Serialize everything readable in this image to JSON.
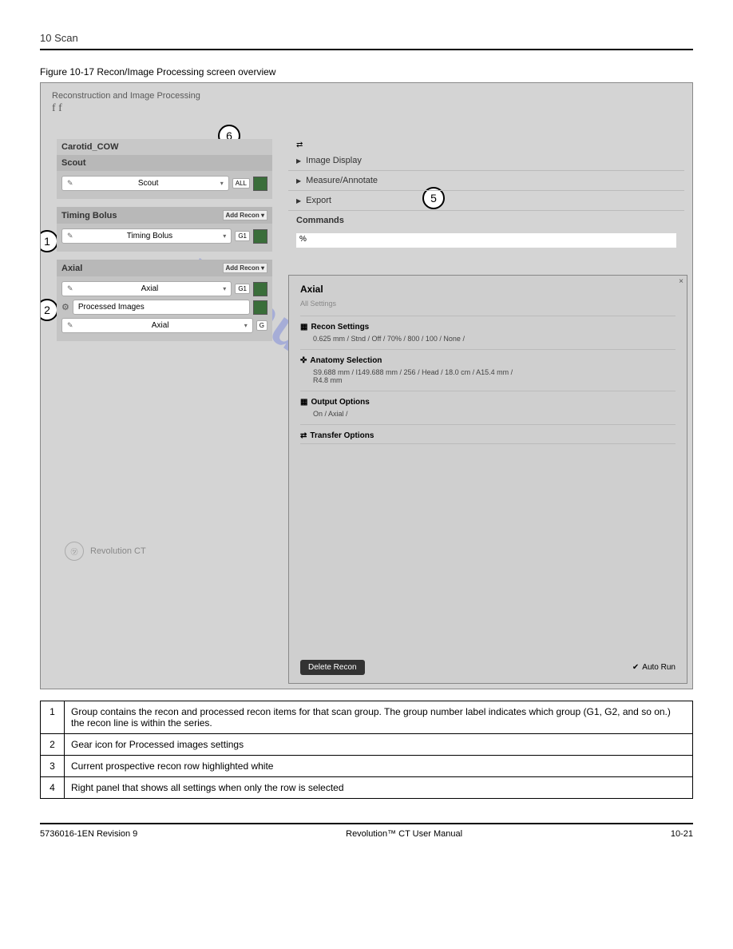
{
  "chapter": {
    "num": "10",
    "title": "Scan"
  },
  "figure_label": "Figure 10-17 Recon/Image Processing screen overview",
  "app_header": "Reconstruction and Image Processing",
  "app_sub": "f f",
  "protocol": "Carotid_COW",
  "sections": {
    "scout": {
      "header": "Scout",
      "item": "Scout",
      "badge": "ALL"
    },
    "timing": {
      "header": "Timing Bolus",
      "add": "Add Recon",
      "item": "Timing Bolus",
      "badge": "G1"
    },
    "axial": {
      "header": "Axial",
      "add": "Add Recon",
      "item1": "Axial",
      "badge1": "G1",
      "processed": "Processed Images",
      "item2": "Axial"
    }
  },
  "right_items": [
    "Image Display",
    "Measure/Annotate",
    "Export",
    "Commands"
  ],
  "cmd_value": "%",
  "panel": {
    "title": "Axial",
    "subtitle": "All Settings",
    "recon_title": "Recon Settings",
    "recon_vals": "0.625 mm  /  Stnd  /  Off  /  70%  /  800  /  100  /  None  /",
    "anatomy_title": "Anatomy Selection",
    "anatomy_vals": "S9.688 mm  /  I149.688 mm  /  256  /  Head  /  18.0 cm  /  A15.4 mm  /",
    "anatomy_vals2": "R4.8 mm",
    "output_title": "Output Options",
    "output_vals": "On  /  Axial  /",
    "transfer_title": "Transfer Options",
    "delete": "Delete Recon",
    "autorun": "Auto Run"
  },
  "brand": "Revolution CT",
  "watermark": "manualshive.com",
  "table": [
    {
      "n": "1",
      "t": "Group contains the recon and processed recon items for that scan group. The group number label indicates which group (G1, G2, and so on.) the recon line is within the series."
    },
    {
      "n": "2",
      "t": "Gear icon for Processed images settings"
    },
    {
      "n": "3",
      "t": "Current prospective recon row highlighted white"
    },
    {
      "n": "4",
      "t": "Right panel that shows all settings when only the row is selected"
    }
  ],
  "footer": {
    "left": "5736016-1EN Revision 9",
    "center": "Revolution™ CT User Manual",
    "right": "10-21"
  }
}
